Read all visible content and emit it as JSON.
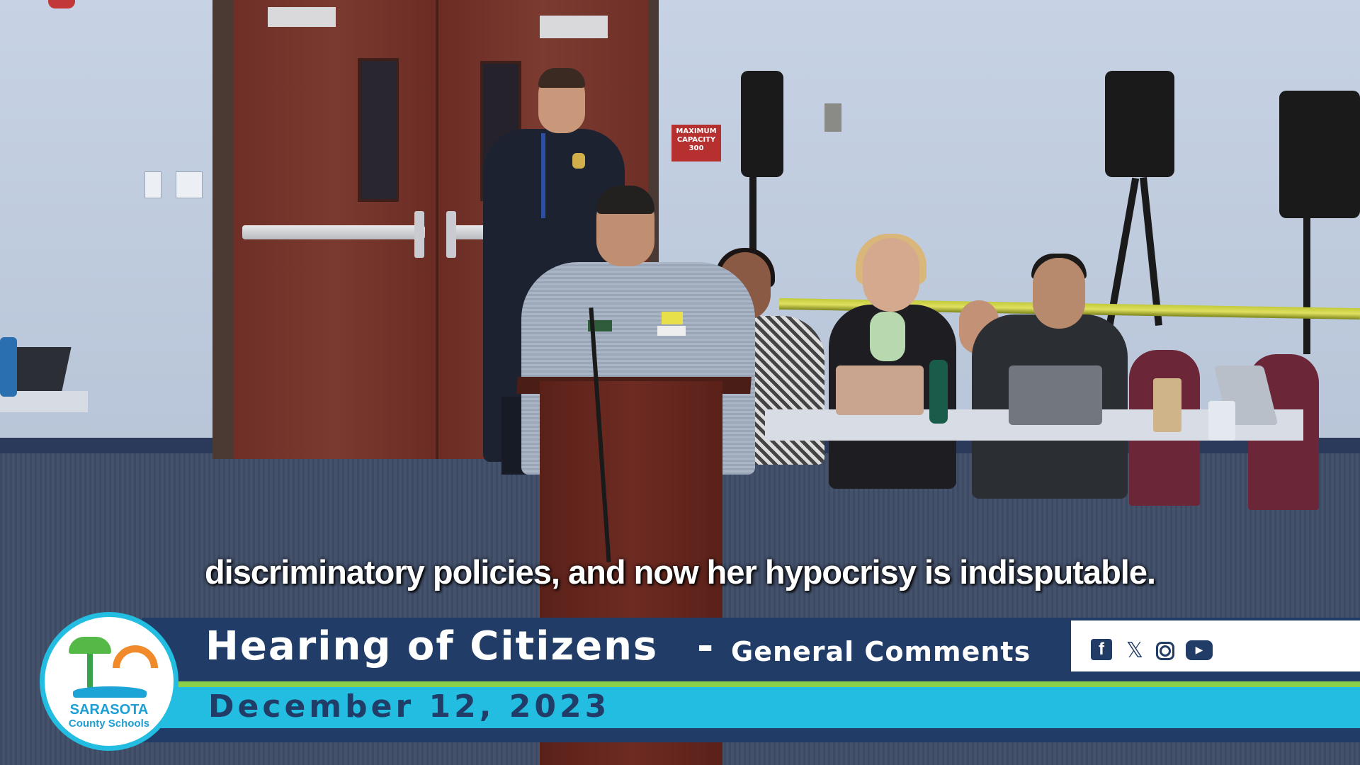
{
  "scene": {
    "capacity_sign": "MAXIMUM CAPACITY 300"
  },
  "caption": {
    "text": "discriminatory policies, and now her hypocrisy is indisputable."
  },
  "lower_third": {
    "title": "Hearing of Citizens",
    "separator": "-",
    "subtitle": "General Comments",
    "date": "December 12, 2023",
    "colors": {
      "navy": "#213c66",
      "cyan": "#22bde0",
      "green": "#8bd04a"
    },
    "social_icons": [
      "facebook-icon",
      "x-icon",
      "instagram-icon",
      "youtube-icon"
    ]
  },
  "logo": {
    "name": "SARASOTA",
    "subtitle": "County Schools"
  }
}
